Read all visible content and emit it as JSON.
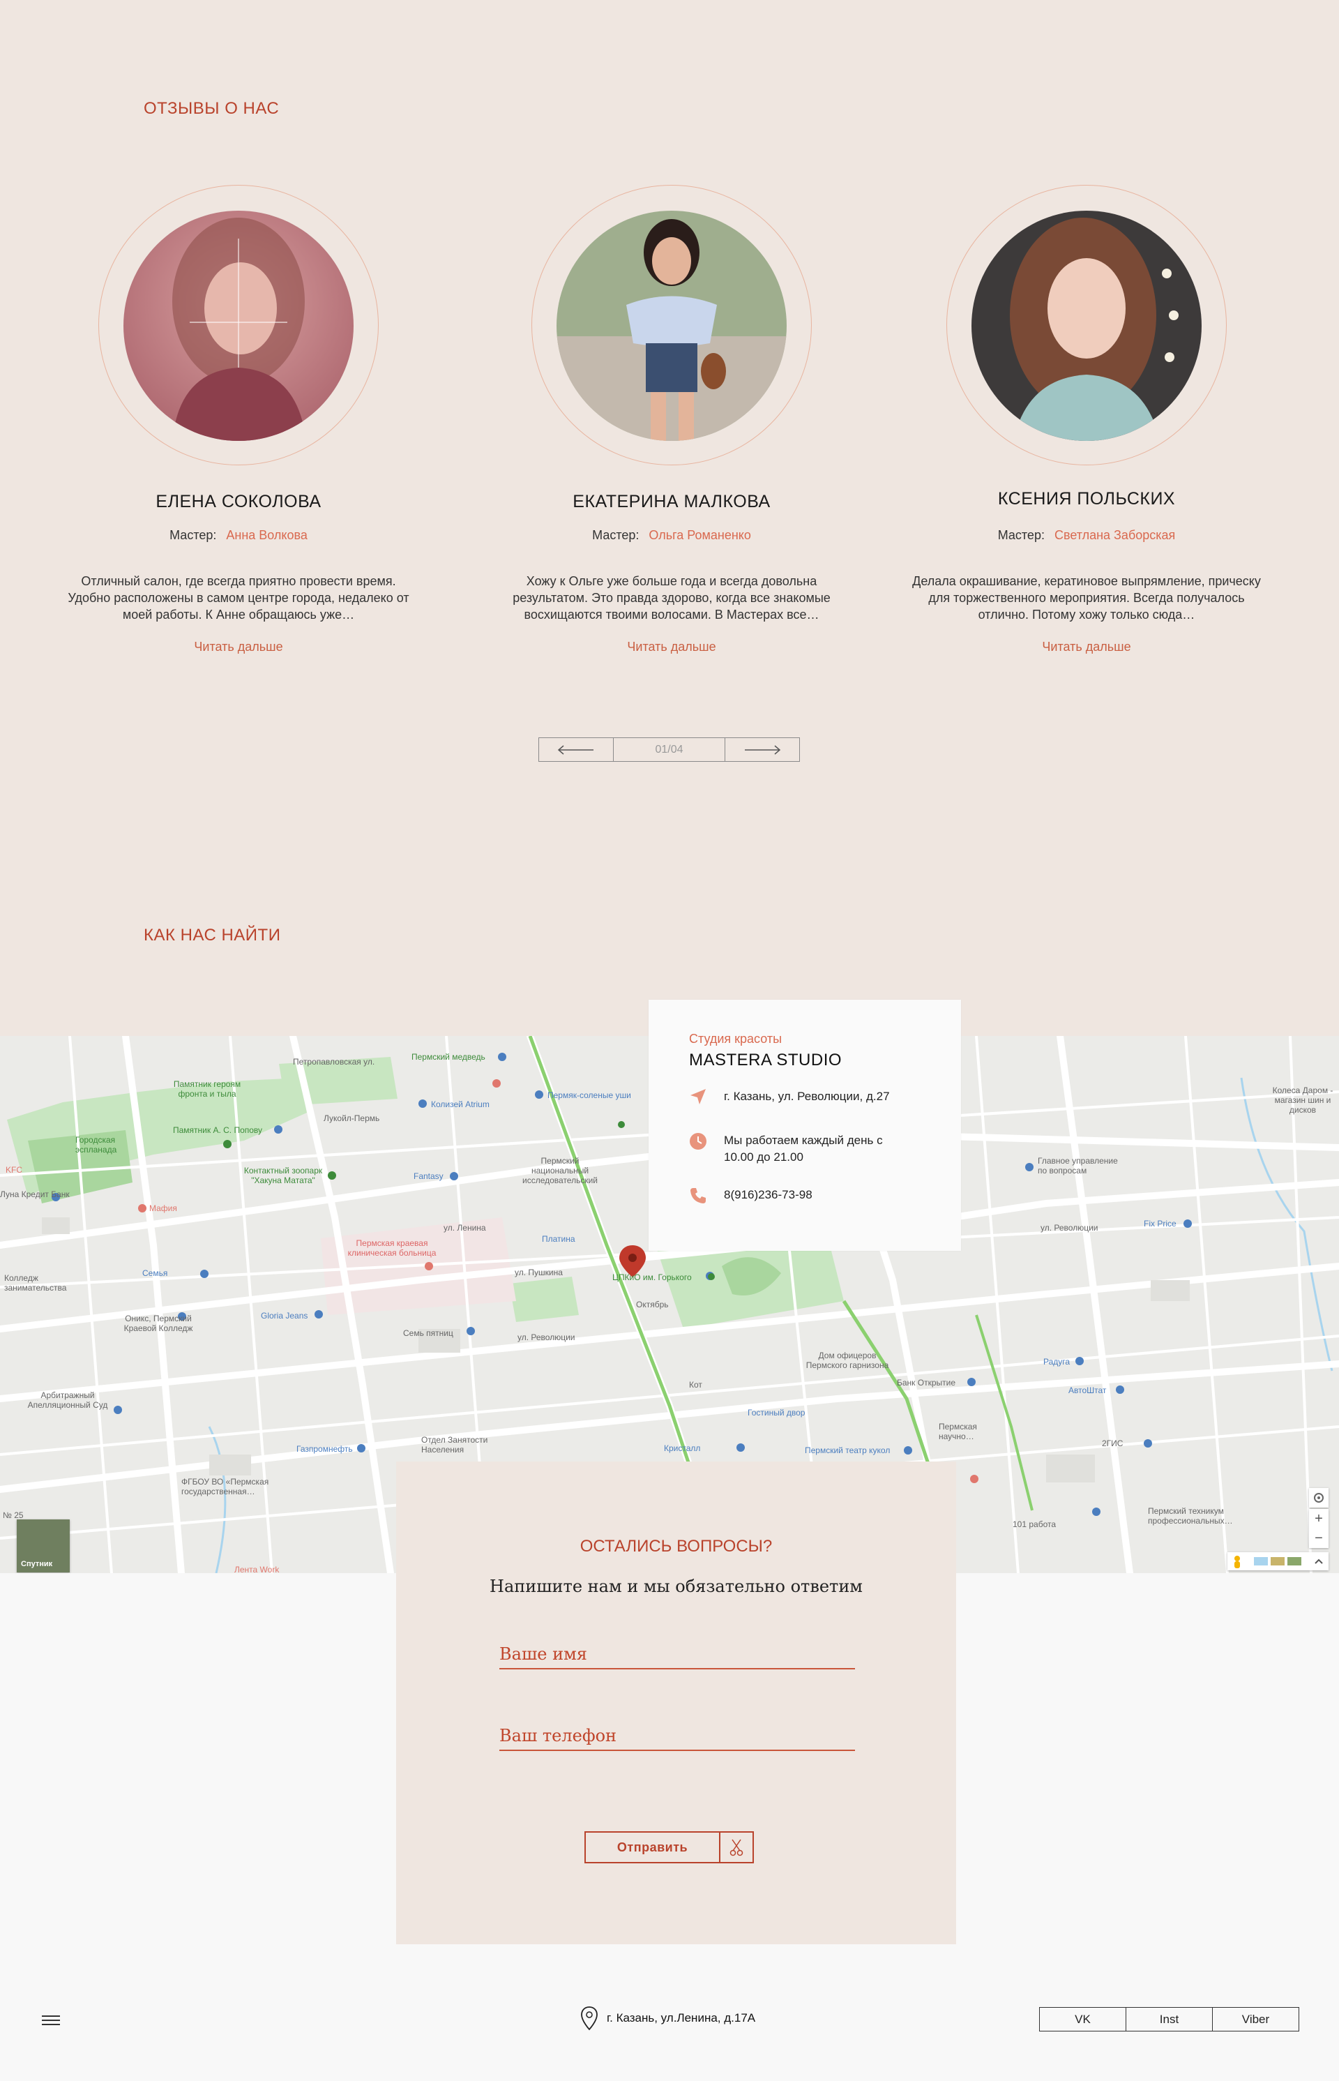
{
  "reviews": {
    "title": "ОТЗЫВЫ О НАС",
    "master_label": "Мастер:",
    "read_more": "Читать дальше",
    "items": [
      {
        "name": "ЕЛЕНА СОКОЛОВА",
        "master": "Анна Волкова",
        "text": "Отличный салон, где всегда приятно провести время. Удобно расположены в самом центре города, недалеко от моей работы. К Анне обращаюсь уже…"
      },
      {
        "name": "ЕКАТЕРИНА МАЛКОВА",
        "master": "Ольга Романенко",
        "text": "Хожу к Ольге уже больше года и всегда довольна результатом. Это правда здорово, когда все знакомые восхищаются твоими волосами. В Мастерах все…"
      },
      {
        "name": "КСЕНИЯ ПОЛЬСКИХ",
        "master": "Светлана Заборская",
        "text": "Делала окрашивание, кератиновое выпрямление, прическу для торжественного мероприятия. Всегда получалось отлично. Потому хожу только сюда…"
      }
    ],
    "pager": {
      "counter": "01/04"
    }
  },
  "find": {
    "title": "КАК НАС НАЙТИ",
    "card": {
      "kind": "Студия красоты",
      "studio": "MASTERA STUDIO",
      "address": "г. Казань, ул. Революции, д.27",
      "hours": "Мы работаем каждый день с 10.00 до 21.00",
      "phone": "8(916)236-73-98"
    },
    "map": {
      "satellite_label": "Спутник",
      "labels": {
        "l1": "Петропавловская ул.",
        "l2": "Пермский медведь",
        "l3": "Памятник героям фронта и тыла",
        "l4": "Колизей Atrium",
        "l5": "Пермяк-соленые уши",
        "l6": "Городская эспланада",
        "l7": "Памятник А. С. Попову",
        "l8": "Лукойл-Пермь",
        "l9": "Контактный зоопарк \"Хакуна Матата\"",
        "l10": "Fantasy",
        "l11": "Пермский национальный исследовательский",
        "l12": "Мафия",
        "l13": "Пермская краевая клиническая больница",
        "l14": "Платина",
        "l15": "ЦПКиО им. Горького",
        "l16": "Семья",
        "l17": "Колледж занимательства",
        "l18": "Октябрь",
        "l19": "Оникс, Пермский Краевой Колледж",
        "l20": "Gloria Jeans",
        "l21": "Семь пятниц",
        "l22": "ул. Революции",
        "l23": "Арбитражный Апелляционный Суд",
        "l24": "Газпромнефть",
        "l25": "Отдел Занятости Населения",
        "l26": "ФГБОУ ВО «Пермская государственная…",
        "l27": "Кот",
        "l28": "Гостиный двор",
        "l29": "Дом офицеров Пермского гарнизона",
        "l30": "Банк Открытие",
        "l31": "Кристалл",
        "l32": "Пермский театр кукол",
        "l33": "Главное управление по вопросам",
        "l34": "Колеса Даром - магазин шин и дисков",
        "l35": "Fix Price",
        "l36": "ул. Революции",
        "l37": "Радуга",
        "l38": "АвтоШтат",
        "l39": "2ГИС",
        "l40": "Пермская научно…",
        "l41": "101 работа",
        "l42": "Пермский техникум профессиональных…",
        "l43": "KFC",
        "l44": "Луна Кредит Банк",
        "l45": "ул. Пушкина",
        "l46": "ул. Ленина",
        "l47": "Лента Work",
        "l48": "№ 25"
      }
    }
  },
  "form": {
    "title": "ОСТАЛИСЬ ВОПРОСЫ?",
    "subtitle": "Напишите нам и мы обязательно ответим",
    "name_placeholder": "Ваше имя",
    "phone_placeholder": "Ваш телефон",
    "submit": "Отправить"
  },
  "footer": {
    "address": "г. Казань, ул.Ленина, д.17А",
    "socials": [
      "VK",
      "Inst",
      "Viber"
    ]
  },
  "colors": {
    "accent": "#b9432c",
    "accent_light": "#d9694f",
    "beige": "#efe6e0"
  },
  "icons": [
    "menu-icon",
    "location-pin-icon",
    "navigation-arrow-icon",
    "clock-icon",
    "phone-icon",
    "scissors-icon",
    "arrow-left-icon",
    "arrow-right-icon"
  ]
}
